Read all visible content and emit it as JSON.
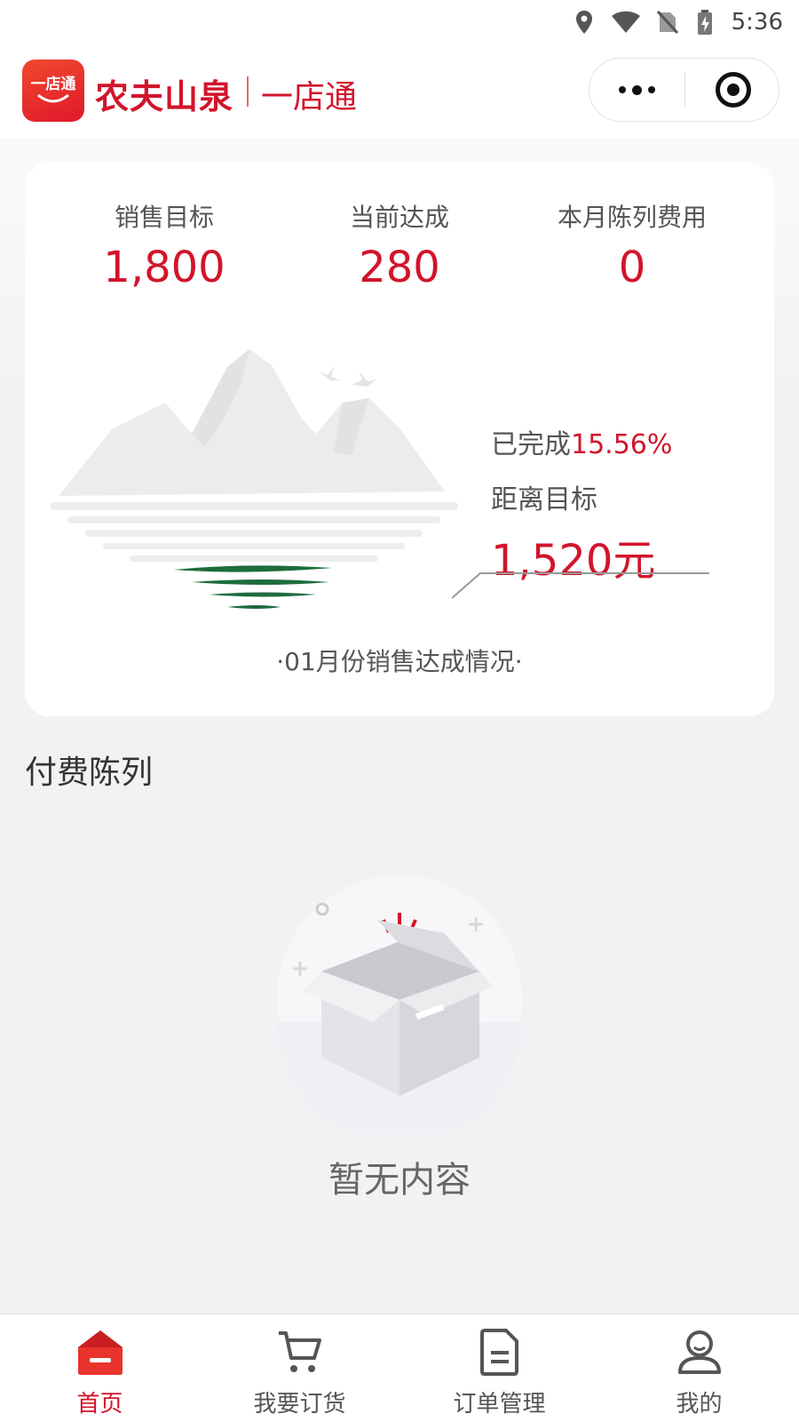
{
  "status_bar": {
    "time": "5:36"
  },
  "header": {
    "logo_text": "一店通",
    "brand": "农夫山泉",
    "subtitle": "一店通"
  },
  "stats": [
    {
      "label": "销售目标",
      "value": "1,800"
    },
    {
      "label": "当前达成",
      "value": "280"
    },
    {
      "label": "本月陈列费用",
      "value": "0"
    }
  ],
  "progress": {
    "completed_label": "已完成",
    "completed_pct": "15.56%",
    "remaining_label": "距离目标",
    "remaining_value": "1,520元"
  },
  "card_caption": "·01月份销售达成情况·",
  "section": {
    "title": "付费陈列"
  },
  "empty": {
    "text": "暂无内容"
  },
  "tabs": [
    {
      "label": "首页",
      "icon": "home-icon",
      "active": true
    },
    {
      "label": "我要订货",
      "icon": "cart-icon",
      "active": false
    },
    {
      "label": "订单管理",
      "icon": "order-document-icon",
      "active": false
    },
    {
      "label": "我的",
      "icon": "user-profile-icon",
      "active": false
    }
  ],
  "colors": {
    "accent": "#d2142b",
    "background": "#f2f2f2",
    "green": "#1e6b3c"
  }
}
